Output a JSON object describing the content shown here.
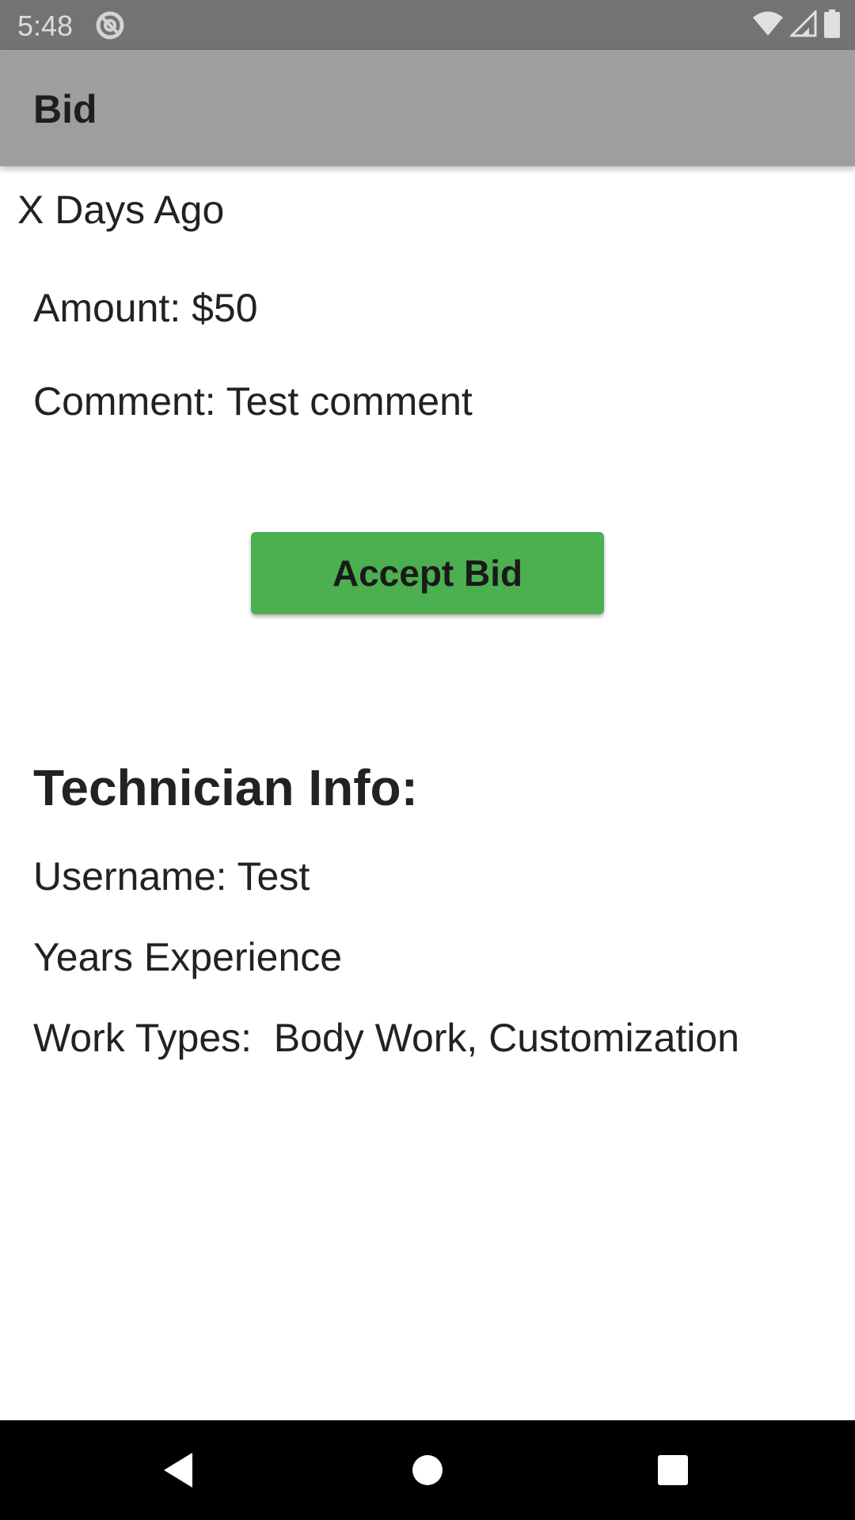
{
  "status_bar": {
    "time": "5:48",
    "icons": [
      "at-sign-icon",
      "wifi-icon",
      "signal-icon",
      "battery-icon"
    ]
  },
  "app_bar": {
    "title": "Bid"
  },
  "bid": {
    "date_text": "X Days Ago",
    "amount_text": "Amount: $50",
    "comment_text": "Comment: Test comment",
    "accept_label": "Accept Bid"
  },
  "technician": {
    "heading": "Technician Info:",
    "username_text": "Username: Test",
    "experience_text": "Years Experience",
    "work_types_text": "Work Types:  Body Work, Customization"
  },
  "nav_bar": {
    "buttons": [
      "back-icon",
      "home-icon",
      "recents-icon"
    ]
  },
  "colors": {
    "status_bar": "#737373",
    "app_bar": "#9e9e9e",
    "accept_button": "#4caf50",
    "nav_bar": "#000000",
    "text": "#222222"
  }
}
